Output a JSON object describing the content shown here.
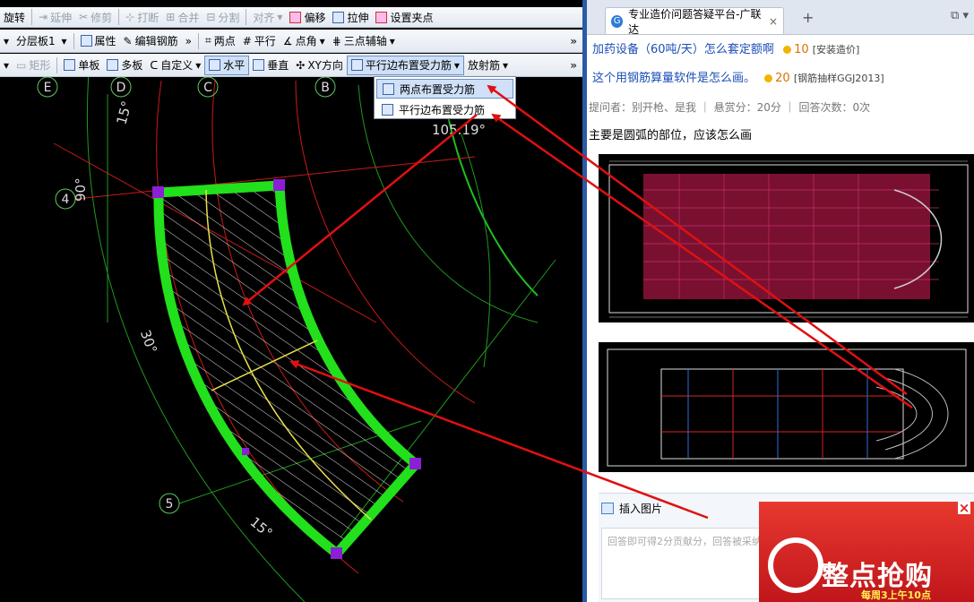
{
  "cad": {
    "toolbar1": [
      "旋转",
      "延伸",
      "修剪",
      "打断",
      "合并",
      "分割",
      "对齐",
      "偏移",
      "拉伸",
      "设置夹点"
    ],
    "toolbar2": {
      "layer": "分层板1",
      "attr": "属性",
      "edit": "编辑钢筋",
      "chev": "»",
      "two_points": "两点",
      "parallel": "平行",
      "point_angle": "点角",
      "three_axis": "三点辅轴",
      "chev2": "»"
    },
    "toolbar3": {
      "rect": "矩形",
      "single": "单板",
      "multi": "多板",
      "custom": "自定义",
      "horizontal": "水平",
      "vertical": "垂直",
      "xy": "XY方向",
      "parallel_edge": "平行边布置受力筋",
      "radial": "放射筋",
      "chev": "»"
    },
    "dropdown": [
      "两点布置受力筋",
      "平行边布置受力筋"
    ],
    "axes": {
      "e": "E",
      "d": "D",
      "c": "C",
      "b": "B",
      "n4": "4",
      "n5": "5"
    },
    "angles": {
      "a1": "15°",
      "a2": "90°",
      "a3": "30°",
      "a4": "15°",
      "a5": "105.19°"
    }
  },
  "browser": {
    "tab_title": "专业造价问题答疑平台-广联达",
    "tab_close": "×",
    "new_tab": "+",
    "questions": [
      {
        "title": "加药设备（60吨/天）怎么套定额啊",
        "points": "10",
        "tag": "[安装造价]"
      },
      {
        "title": "这个用钢筋算量软件是怎么画。",
        "points": "20",
        "tag": "[钢筋抽样GGJ2013]"
      }
    ],
    "meta": "提问者：别开枪、是我  ｜  悬赏分：20分  ｜  回答次数：0次",
    "question_text": "主要是圆弧的部位，应该怎么画",
    "insert_image": "插入图片",
    "answer_placeholder": "回答即可得2分贡献分，回答被采纳"
  },
  "ad": {
    "title": "整点抢购",
    "subtitle": "每周3上午10点",
    "close": "×"
  },
  "colors": {
    "slab": "#22e01b",
    "arrow": "#e01010",
    "accent": "#2a5aa8"
  }
}
